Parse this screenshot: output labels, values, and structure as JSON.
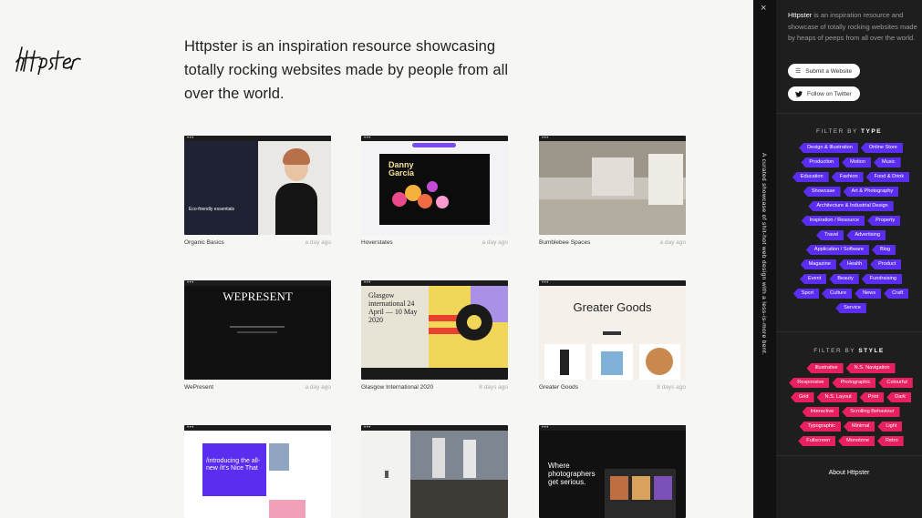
{
  "logo": {
    "text": "httpster"
  },
  "intro": {
    "text": "Httpster is an inspiration resource showcasing totally rocking websites made by people from all over the world."
  },
  "cards": [
    {
      "title": "Organic Basics",
      "age": "a day ago",
      "thumb_text": "Eco-friendly essentials"
    },
    {
      "title": "Hoverstates",
      "age": "a day ago",
      "thumb_text": "Danny\nGarcia"
    },
    {
      "title": "Bumblebee Spaces",
      "age": "a day ago",
      "thumb_text": ""
    },
    {
      "title": "WePresent",
      "age": "a day ago",
      "thumb_text": "WEPRESENT"
    },
    {
      "title": "Glasgow International 2020",
      "age": "8 days ago",
      "thumb_text": "Glasgow international 24 April — 10 May 2020"
    },
    {
      "title": "Greater Goods",
      "age": "8 days ago",
      "thumb_text": "Greater Goods"
    },
    {
      "title": "",
      "age": "",
      "thumb_text": "/introducing the all-new /it's Nice That"
    },
    {
      "title": "",
      "age": "",
      "thumb_text": ""
    },
    {
      "title": "",
      "age": "",
      "thumb_text": "Where photographers get serious."
    }
  ],
  "divider": {
    "close": "×",
    "vertical_text": "A curated showcase of shit-hot web design with a less-is-more bent."
  },
  "sidebar": {
    "about_brand": "Httpster",
    "about_text": " is an inspiration resource and showcase of totally rocking websites made by heaps of peeps from all over the world.",
    "submit_label": "Submit a Website",
    "twitter_label": "Follow on Twitter",
    "filter_type_prefix": "FILTER BY ",
    "filter_type_word": "TYPE",
    "type_tags": [
      "Design & Illustration",
      "Online Store",
      "Production",
      "Motion",
      "Music",
      "Education",
      "Fashion",
      "Food & Drink",
      "Showcase",
      "Art & Photography",
      "Architecture & Industrial Design",
      "Inspiration / Resource",
      "Property",
      "Travel",
      "Advertising",
      "Application / Software",
      "Blog",
      "Magazine",
      "Health",
      "Product",
      "Event",
      "Beauty",
      "Fundraising",
      "Sport",
      "Culture",
      "News",
      "Craft",
      "Service"
    ],
    "filter_style_prefix": "FILTER BY ",
    "filter_style_word": "STYLE",
    "style_tags": [
      "Illustrative",
      "N.S. Navigation",
      "Responsive",
      "Photographic",
      "Colourful",
      "Grid",
      "N.S. Layout",
      "Print",
      "Dark",
      "Interactive",
      "Scrolling Behaviour",
      "Typographic",
      "Minimal",
      "Light",
      "Fullscreen",
      "Monotone",
      "Retro"
    ],
    "about_link": "About Httpster"
  },
  "colors": {
    "type_tag": "#5b2df0",
    "style_tag": "#e8205f",
    "sidebar_bg": "#1e1e1e"
  }
}
